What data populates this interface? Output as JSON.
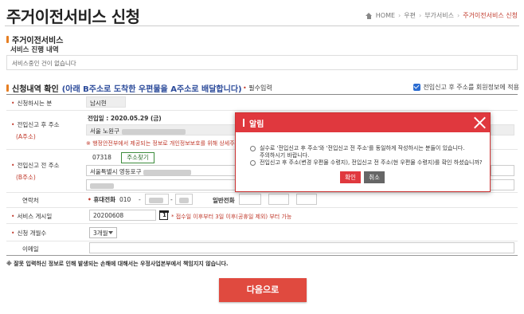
{
  "page": {
    "title": "주거이전서비스 신청"
  },
  "breadcrumb": [
    "HOME",
    "우편",
    "부가서비스",
    "주거이전서비스 신청"
  ],
  "service_section": {
    "title": "주거이전서비스",
    "subtitle": "서비스 진행 내역",
    "progress_text": "서비스중인 건이 없습니다"
  },
  "application": {
    "title_prefix": "신청내역 확인",
    "title_highlight": "(아래 B주소로 도착한 우편물을 A주소로 배달합니다)",
    "required_text": "필수입력",
    "agree_label": "전입신고 후 주소를 회원정보에 적용",
    "agree_checked": true
  },
  "form": {
    "applicant": {
      "label": "신청하시는 분",
      "value": "남시현"
    },
    "new_address": {
      "label": "전입신고 후 주소",
      "sub": "(A주소)",
      "move_in_date": "전입일 : 2020.05.29 (금)",
      "line1": "서울 노원구",
      "note": "※ 행정안전부에서 제공되는 정보로 개인정보보호를 위해 상세주소를"
    },
    "old_address": {
      "label": "전입신고 전 주소",
      "sub": "(B주소)",
      "zip": "07318",
      "find_button": "주소찾기",
      "line1": "서울특별시 영등포구"
    },
    "contact": {
      "label": "연락처",
      "mobile_label": "휴대전화",
      "mobile_prefix": "010",
      "dash": "-",
      "phone_label": "일반전화"
    },
    "start_date": {
      "label": "서비스 게시일",
      "value": "20200608",
      "calendar_icon_text": "1",
      "note": "* 접수일 이후부터 3일 이후(공휴일 제외) 부터 가능"
    },
    "months": {
      "label": "신청 개월수",
      "value": "3개월"
    },
    "email": {
      "label": "이메일"
    }
  },
  "notice": "※ 잘못 입력하신 정보로 인해 발생되는 손해에 대해서는 우정사업본부에서 책임지지 않습니다.",
  "next_button": "다음으로",
  "modal": {
    "title": "알림",
    "option1_line1": "실수로 '전입신고 후 주소'와 '전입신고 전 주소'를 동일하게 작성하시는 분들이 있습니다.",
    "option1_line2": "주의하시기 바랍니다.",
    "option2": "전입신고 후 주소(변경 우편물 수령지), 전입신고 전 주소(현 우편물 수령지)를 확인 하셨습니까?",
    "ok": "확인",
    "cancel": "취소"
  },
  "colors": {
    "accent_red": "#e0383e",
    "highlight_blue": "#2b4a9a",
    "bullet_orange": "#e67e22"
  }
}
